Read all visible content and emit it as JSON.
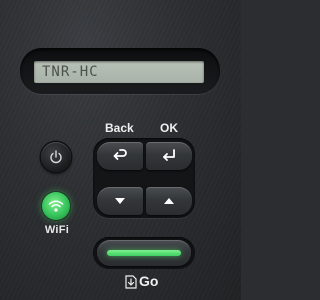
{
  "lcd": {
    "text": "TNR-HC"
  },
  "buttons": {
    "back_label": "Back",
    "ok_label": "OK",
    "minus_label": "−",
    "plus_label": "+",
    "wifi_label": "WiFi",
    "go_label": "Go"
  },
  "icons": {
    "power": "power-icon",
    "wifi": "wifi-icon",
    "back": "return-arrow-icon",
    "ok": "enter-arrow-icon",
    "down": "triangle-down-icon",
    "up": "triangle-up-icon",
    "go": "document-arrow-icon"
  },
  "colors": {
    "wifi_led": "#35c25a",
    "go_led": "#3fcf62",
    "lcd": "#b9c1b7"
  }
}
